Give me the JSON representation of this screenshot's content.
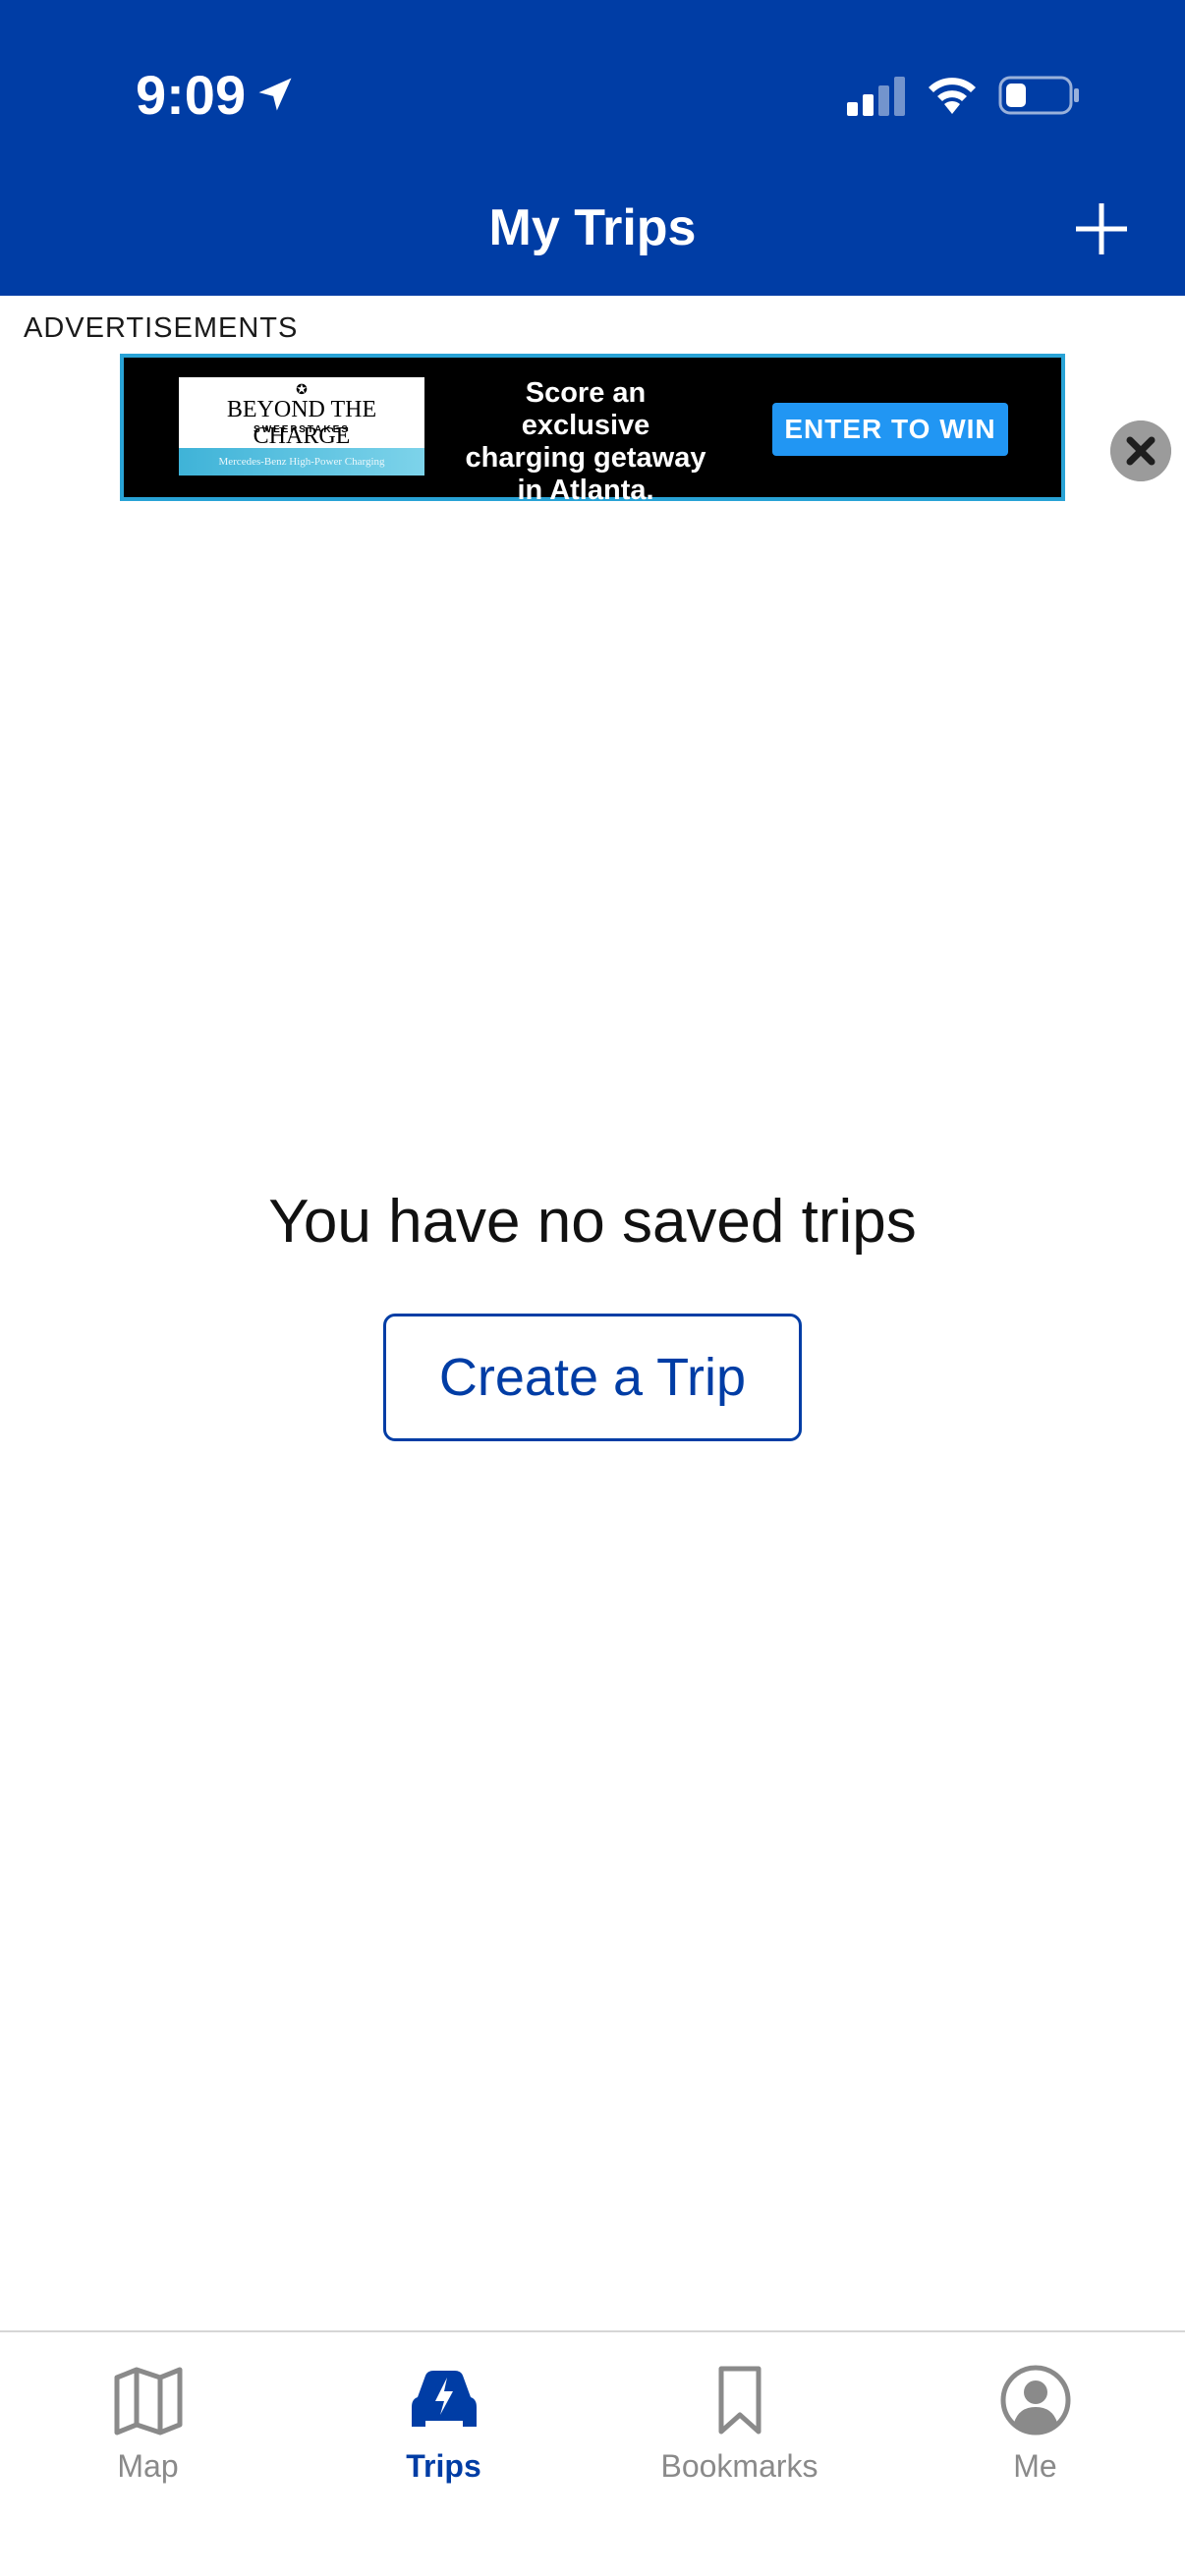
{
  "status_bar": {
    "time": "9:09"
  },
  "header": {
    "title": "My Trips",
    "add_icon": "plus-icon"
  },
  "ad": {
    "label": "ADVERTISEMENTS",
    "logo_title": "BEYOND THE CHARGE",
    "logo_subtitle": "SWEEPSTAKES",
    "logo_tagline": "Mercedes-Benz High-Power Charging",
    "copy": "Score an exclusive charging getaway in Atlanta.",
    "cta": "ENTER TO WIN",
    "close_icon": "close-icon"
  },
  "empty_state": {
    "message": "You have no saved trips",
    "button_label": "Create a Trip"
  },
  "tabs": [
    {
      "label": "Map",
      "icon": "map-icon",
      "active": false
    },
    {
      "label": "Trips",
      "icon": "car-bolt-icon",
      "active": true
    },
    {
      "label": "Bookmarks",
      "icon": "bookmark-icon",
      "active": false
    },
    {
      "label": "Me",
      "icon": "user-icon",
      "active": false
    }
  ],
  "colors": {
    "brand": "#003da5",
    "inactive_tab": "#8a8a8a",
    "ad_cta": "#2196f3"
  }
}
